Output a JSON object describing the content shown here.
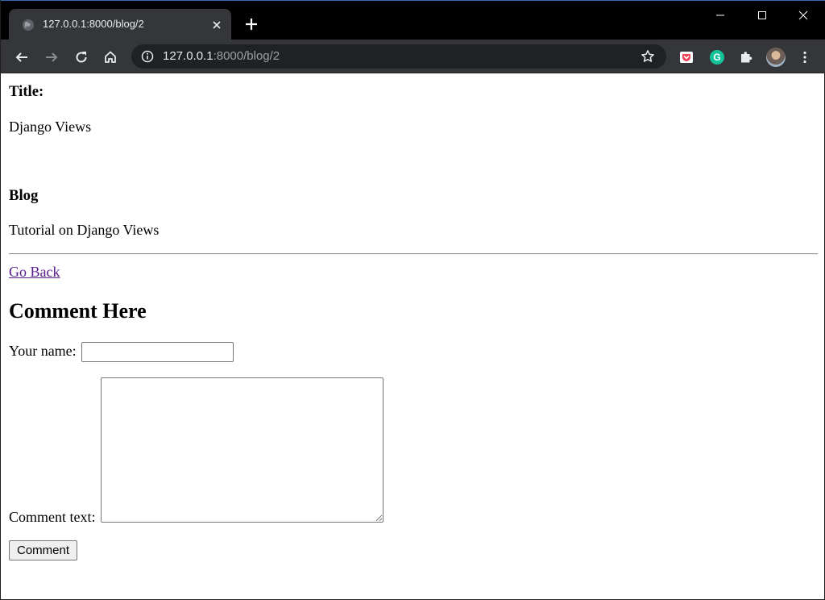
{
  "browser": {
    "tab_title": "127.0.0.1:8000/blog/2",
    "url_host": "127.0.0.1",
    "url_rest": ":8000/blog/2"
  },
  "page": {
    "title_heading": "Title:",
    "title_value": "Django Views",
    "blog_heading": "Blog",
    "blog_value": "Tutorial on Django Views",
    "back_link": "Go Back",
    "comment_heading": "Comment Here",
    "form": {
      "name_label": "Your name:",
      "name_value": "",
      "comment_label": "Comment text:",
      "comment_value": "",
      "submit_label": "Comment"
    }
  },
  "icons": {
    "favicon": "globe-icon",
    "tab_close": "close-icon",
    "new_tab": "plus-icon",
    "back": "arrow-left-icon",
    "forward": "arrow-right-icon",
    "reload": "reload-icon",
    "home": "home-icon",
    "site_info": "info-icon",
    "bookmark": "star-icon",
    "pocket": "pocket-icon",
    "grammarly": "grammarly-icon",
    "extensions": "puzzle-icon",
    "profile": "avatar",
    "menu": "kebab-menu-icon"
  },
  "colors": {
    "titlebar": "#000000",
    "tab": "#35363a",
    "toolbar": "#35363a",
    "omnibox": "#202124",
    "link_visited": "#551a8b",
    "grammarly": "#15c39a",
    "pocket": "#ef4056"
  }
}
